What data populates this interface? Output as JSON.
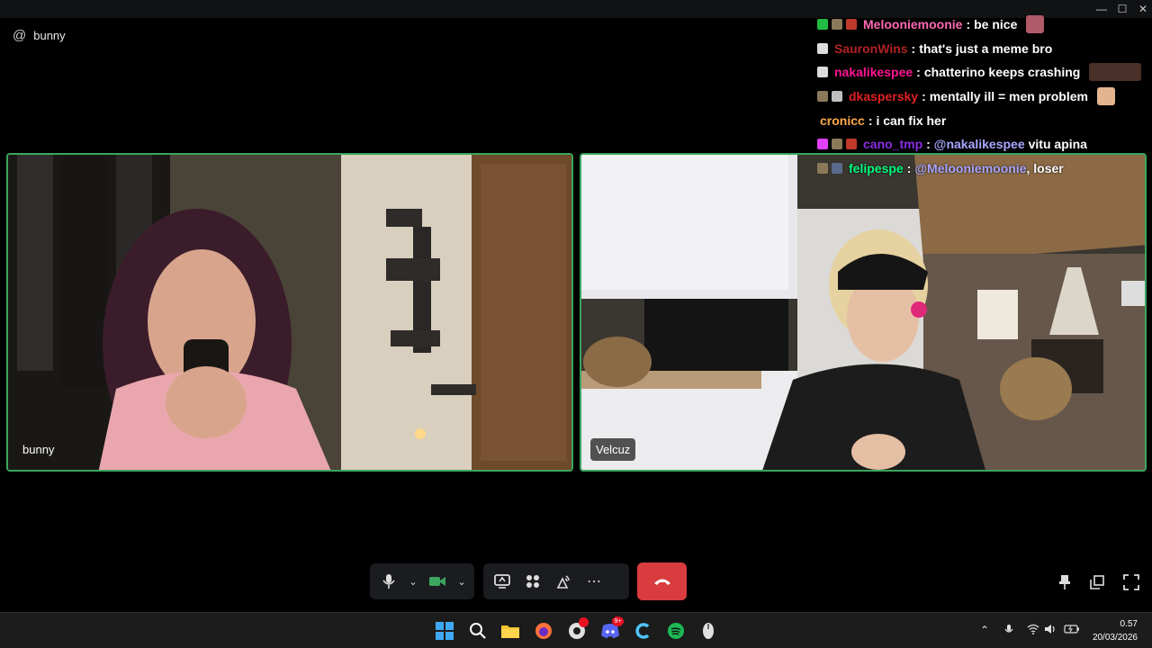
{
  "window": {
    "channel_name": "bunny",
    "controls": [
      "minimize-icon",
      "maximize-icon",
      "close-icon"
    ]
  },
  "participants": [
    {
      "name": "bunny",
      "speaking": true
    },
    {
      "name": "Velcuz",
      "speaking": true
    }
  ],
  "chat": [
    {
      "user": "Melooniemoonie",
      "color": "#ff69b4",
      "badges": [
        "check",
        "sub",
        "mod"
      ],
      "text": "be nice",
      "emote": true
    },
    {
      "user": "SauronWins",
      "color": "#b22222",
      "badges": [
        "mute"
      ],
      "text": "that's just a meme bro",
      "emote": false
    },
    {
      "user": "nakalikespee",
      "color": "#ff1493",
      "badges": [
        "mute"
      ],
      "text": "chatterino keeps crashing",
      "emote": true
    },
    {
      "user": "dkaspersky",
      "color": "#e02020",
      "badges": [
        "sub",
        "bits"
      ],
      "text": "mentally ill = men problem",
      "emote": true
    },
    {
      "user": "cronicc",
      "color": "#ffa94d",
      "badges": [],
      "text": "i can fix her",
      "emote": false
    },
    {
      "user": "cano_tmp",
      "color": "#8a2be2",
      "badges": [
        "heart",
        "sub",
        "mod"
      ],
      "text": "vitu apina",
      "mention": "@nakalikespee",
      "emote": false
    },
    {
      "user": "felipespe",
      "color": "#00ff7f",
      "badges": [
        "sub",
        "mod"
      ],
      "text": ", loser",
      "mention": "@Melooniemoonie",
      "emote": false
    }
  ],
  "controls": {
    "mic": "microphone-icon",
    "camera": "video-camera-icon",
    "screen_share": "screen-share-icon",
    "activities": "activities-icon",
    "soundboard": "soundboard-icon",
    "more": "more-icon",
    "hangup": "hangup-icon",
    "accent": "#3ba55d",
    "danger": "#d83c3e"
  },
  "taskbar": {
    "apps": [
      "windows-start-icon",
      "search-icon",
      "file-explorer-icon",
      "firefox-icon",
      "chrome-icon",
      "discord-icon",
      "ccleaner-icon",
      "spotify-icon",
      "mouse-app-icon"
    ],
    "discord_badge": "9+",
    "time": "0.57",
    "date": "20/03/2026"
  }
}
